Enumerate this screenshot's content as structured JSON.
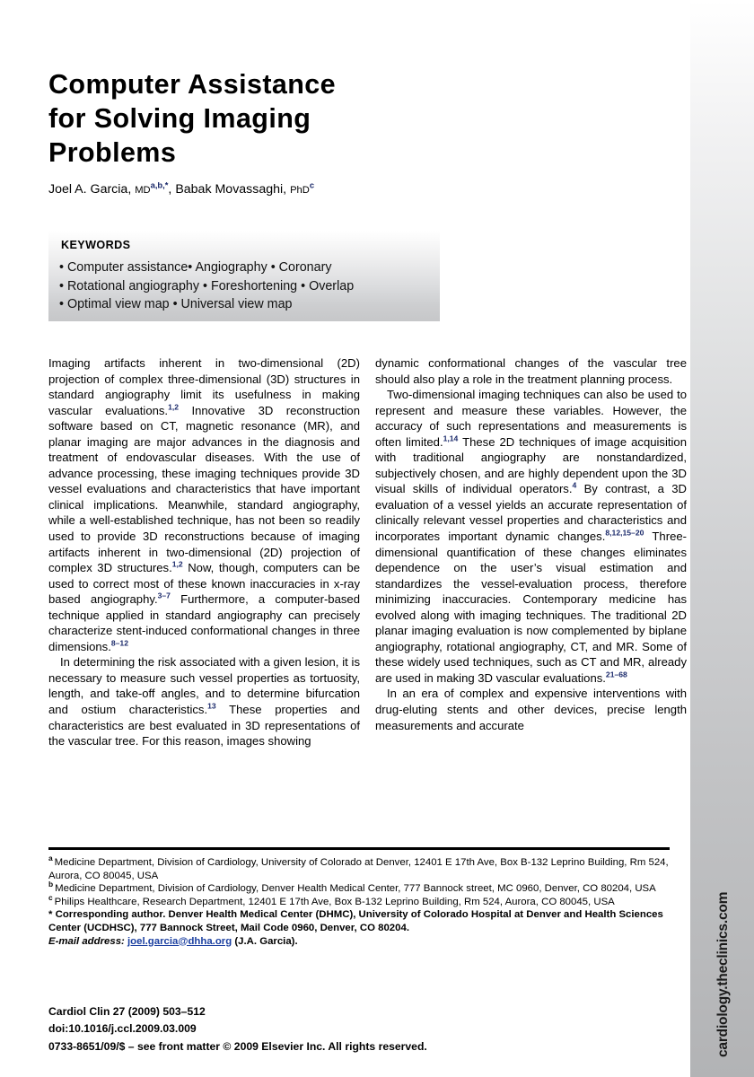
{
  "journal_bar": {
    "url_text": "cardiology.theclinics.com"
  },
  "title": {
    "lines": [
      "Computer Assistance",
      "for Solving Imaging",
      "Problems"
    ]
  },
  "authors": {
    "author1_name": "Joel A. Garcia, ",
    "author1_degree": "MD",
    "author1_sup": "a,b,*",
    "separator": ", ",
    "author2_name": "Babak Movassaghi, ",
    "author2_degree": "PhD",
    "author2_sup": "c"
  },
  "keywords": {
    "heading": "KEYWORDS",
    "lines": [
      "• Computer assistance• Angiography • Coronary",
      "• Rotational angiography • Foreshortening • Overlap",
      "• Optimal view map • Universal view map"
    ]
  },
  "body": {
    "left_column": [
      {
        "indent": false,
        "runs": [
          {
            "t": "Imaging artifacts inherent in two-dimensional (2D) projection of complex three-dimensional (3D) structures in standard angiography limit its usefulness in making vascular evaluations."
          },
          {
            "sup": "1,2"
          },
          {
            "t": " Innovative 3D reconstruction software based on CT, magnetic resonance (MR), and planar imaging are major advances in the diagnosis and treatment of endovascular diseases. With the use of advance processing, these imaging techniques provide 3D vessel evaluations and characteristics that have important clinical implications. Meanwhile, standard angiography, while a well-established technique, has not been so readily used to provide 3D reconstructions because of imaging artifacts inherent in two-dimensional (2D) projection of complex 3D structures."
          },
          {
            "sup": "1,2"
          },
          {
            "t": " Now, though, computers can be used to correct most of these known inaccuracies in x-ray based angiography."
          },
          {
            "sup": "3–7"
          },
          {
            "t": " Furthermore, a computer-based technique applied in standard angiography can precisely characterize stent-induced conformational changes in three dimensions."
          },
          {
            "sup": "8–12"
          }
        ]
      },
      {
        "indent": true,
        "runs": [
          {
            "t": "In determining the risk associated with a given lesion, it is necessary to measure such vessel properties as tortuosity, length, and take-off angles, and to determine bifurcation and ostium characteristics."
          },
          {
            "sup": "13"
          },
          {
            "t": " These properties and characteristics are best evaluated in 3D representations of the vascular tree. For this reason, images showing"
          }
        ]
      }
    ],
    "right_column": [
      {
        "indent": false,
        "runs": [
          {
            "t": "dynamic conformational changes of the vascular tree should also play a role in the treatment planning process."
          }
        ]
      },
      {
        "indent": true,
        "runs": [
          {
            "t": "Two-dimensional imaging techniques can also be used to represent and measure these variables. However, the accuracy of such representations and measurements is often limited."
          },
          {
            "sup": "1,14"
          },
          {
            "t": " These 2D techniques of image acquisition with traditional angiography are nonstandardized, subjectively chosen, and are highly dependent upon the 3D visual skills of individual operators."
          },
          {
            "sup": "4"
          },
          {
            "t": " By contrast, a 3D evaluation of a vessel yields an accurate representation of clinically relevant vessel properties and characteristics and incorporates important dynamic changes."
          },
          {
            "sup": "8,12,15–20"
          },
          {
            "t": " Three-dimensional quantification of these changes eliminates dependence on the user’s visual estimation and standardizes the vessel-evaluation process, therefore minimizing inaccuracies. Contemporary medicine has evolved along with imaging techniques. The traditional 2D planar imaging evaluation is now complemented by biplane angiography, rotational angiography, CT, and MR. Some of these widely used techniques, such as CT and MR, already are used in making 3D vascular evaluations."
          },
          {
            "sup": "21–68"
          }
        ]
      },
      {
        "indent": true,
        "runs": [
          {
            "t": "In an era of complex and expensive interventions with drug-eluting stents and other devices, precise length measurements and accurate"
          }
        ]
      }
    ]
  },
  "footnotes": {
    "items": [
      {
        "marker": "a",
        "text": "Medicine Department, Division of Cardiology, University of Colorado at Denver, 12401 E 17th Ave, Box B-132 Leprino Building, Rm 524, Aurora, CO 80045, USA"
      },
      {
        "marker": "b",
        "text": "Medicine Department, Division of Cardiology, Denver Health Medical Center, 777 Bannock street, MC 0960, Denver, CO 80204, USA"
      },
      {
        "marker": "c",
        "text": "Philips Healthcare, Research Department, 12401 E 17th Ave, Box B-132 Leprino Building, Rm 524, Aurora, CO 80045, USA"
      }
    ],
    "corresponding": "* Corresponding author. Denver Health Medical Center (DHMC), University of Colorado Hospital at Denver and Health Sciences Center (UCDHSC), 777 Bannock Street, Mail Code 0960, Denver, CO 80204.",
    "email_label": "E-mail address:",
    "email_address": "joel.garcia@dhha.org",
    "email_who": "(J.A. Garcia)."
  },
  "citation": {
    "lines": [
      "Cardiol Clin 27 (2009) 503–512",
      "doi:10.1016/j.ccl.2009.03.009",
      "0733-8651/09/$ – see front matter © 2009 Elsevier Inc. All rights reserved."
    ]
  }
}
